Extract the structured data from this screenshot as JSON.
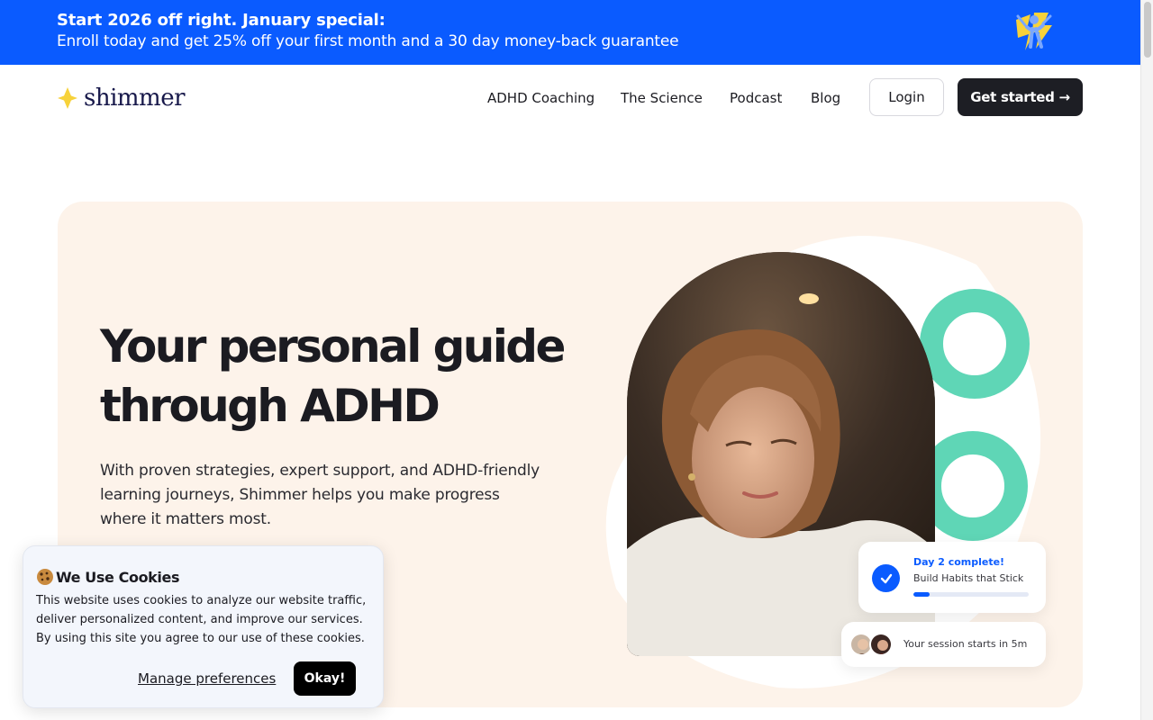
{
  "promo": {
    "headline": "Start 2026 off right. January special:",
    "subtext": "Enroll today and get 25% off your first month and a 30 day money-back guarantee",
    "background": "#0a5bff"
  },
  "header": {
    "logo_text": "shimmer",
    "nav": [
      "ADHD Coaching",
      "The Science",
      "Podcast",
      "Blog"
    ],
    "login_label": "Login",
    "cta_label": "Get started →"
  },
  "hero": {
    "title_line1": "Your personal guide",
    "title_line2": "through ADHD",
    "description": "With proven strategies, expert support, and ADHD-friendly learning journeys, Shimmer helps you make progress where it matters most.",
    "background": "#fdf3ea",
    "progress_card": {
      "status": "Day 2 complete!",
      "task": "Build Habits that Stick",
      "progress_fraction": 0.14
    },
    "session_card": {
      "text": "Your session starts in 5m"
    }
  },
  "cookie": {
    "title": "We Use Cookies",
    "body": "This website uses cookies to analyze our website traffic, deliver personalized content, and improve our services. By using this site you agree to our use of these cookies.",
    "manage_label": "Manage preferences",
    "okay_label": "Okay!"
  },
  "colors": {
    "accent_blue": "#0a5bff",
    "accent_green": "#5fd6b6",
    "logo_yellow": "#f7d23a",
    "dark": "#1d1e24"
  }
}
